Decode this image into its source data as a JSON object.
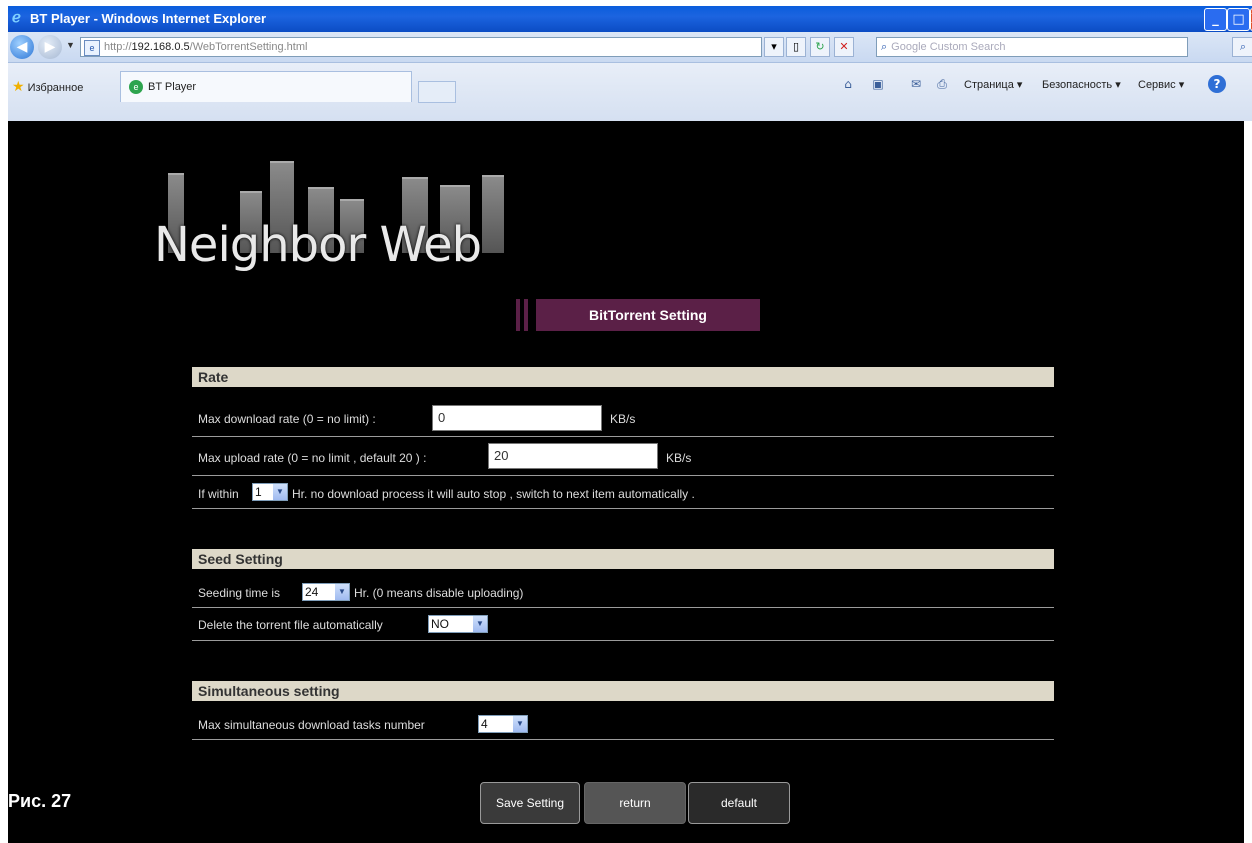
{
  "window": {
    "title": "BT Player - Windows Internet Explorer",
    "min_glyph": "_",
    "max_glyph": "□",
    "close_glyph": "X"
  },
  "addressbar": {
    "url_prefix": "http://",
    "url_host": "192.168.0.5",
    "url_path": "/WebTorrentSetting.html",
    "search_placeholder": "Google Custom Search"
  },
  "tabs": {
    "favorites_label": "Избранное",
    "active_tab": "BT Player",
    "commands": [
      "Страница ▾",
      "Безопасность ▾",
      "Сервис ▾"
    ]
  },
  "page": {
    "logo_text": "Neighbor Web",
    "banner": "BitTorrent Setting",
    "rate": {
      "heading": "Rate",
      "download_label": "Max download rate (0 = no limit) :",
      "download_value": "0",
      "download_unit": "KB/s",
      "upload_label": "Max upload rate (0 = no limit , default 20 ) :",
      "upload_value": "20",
      "upload_unit": "KB/s",
      "auto_stop_prefix": "If within",
      "auto_stop_value": "1",
      "auto_stop_suffix": "Hr. no download process it will auto stop , switch to next item automatically ."
    },
    "seed": {
      "heading": "Seed Setting",
      "seeding_prefix": "Seeding time is",
      "seeding_value": "24",
      "seeding_suffix": "Hr. (0 means disable uploading)",
      "delete_label": "Delete the torrent file automatically",
      "delete_value": "NO"
    },
    "simultaneous": {
      "heading": "Simultaneous setting",
      "tasks_label": "Max simultaneous download tasks number",
      "tasks_value": "4"
    },
    "buttons": {
      "save": "Save Setting",
      "return": "return",
      "default": "default"
    },
    "figure_caption": "Рис. 27"
  }
}
